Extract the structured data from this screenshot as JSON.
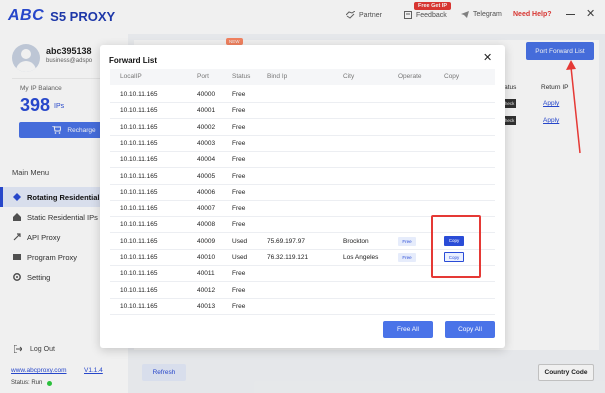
{
  "app": {
    "logo_abc": "ABC",
    "logo_text": "S5 PROXY"
  },
  "topbar": {
    "partner": "Partner",
    "feedback": "Feedback",
    "free_get_ip": "Free Get IP",
    "telegram": "Telegram",
    "need_help": "Need Help?"
  },
  "user": {
    "name": "abc395138",
    "email": "business@adspo"
  },
  "balance": {
    "label": "My IP Balance",
    "value": "398",
    "unit": "IPs",
    "recharge_label": "Recharge"
  },
  "sidebar": {
    "menu_title": "Main Menu",
    "items": [
      {
        "label": "Rotating Residential",
        "icon": "rotate-icon",
        "active": true
      },
      {
        "label": "Static Residential IPs",
        "icon": "house-icon",
        "active": false
      },
      {
        "label": "API Proxy",
        "icon": "api-icon",
        "active": false
      },
      {
        "label": "Program Proxy",
        "icon": "program-icon",
        "active": false
      },
      {
        "label": "Setting",
        "icon": "gear-icon",
        "active": false
      }
    ],
    "logout": "Log Out",
    "site": "www.abcproxy.com",
    "version": "V1.1.4",
    "status": "Status: Run"
  },
  "background": {
    "new_tag": "NEW",
    "port_forward_list": "Port Forward List",
    "col_status": "Status",
    "col_return_ip": "Return IP",
    "check_label": "Check",
    "apply_label": "Apply",
    "refresh": "Refresh",
    "country_code": "Country Code"
  },
  "modal": {
    "title": "Forward List",
    "columns": [
      "LocalIP",
      "Port",
      "Status",
      "Bind Ip",
      "City",
      "Operate",
      "Copy"
    ],
    "rows": [
      {
        "ip": "10.10.11.165",
        "port": "40000",
        "status": "Free",
        "bind": "",
        "city": "",
        "operate": "",
        "copy": ""
      },
      {
        "ip": "10.10.11.165",
        "port": "40001",
        "status": "Free",
        "bind": "",
        "city": "",
        "operate": "",
        "copy": ""
      },
      {
        "ip": "10.10.11.165",
        "port": "40002",
        "status": "Free",
        "bind": "",
        "city": "",
        "operate": "",
        "copy": ""
      },
      {
        "ip": "10.10.11.165",
        "port": "40003",
        "status": "Free",
        "bind": "",
        "city": "",
        "operate": "",
        "copy": ""
      },
      {
        "ip": "10.10.11.165",
        "port": "40004",
        "status": "Free",
        "bind": "",
        "city": "",
        "operate": "",
        "copy": ""
      },
      {
        "ip": "10.10.11.165",
        "port": "40005",
        "status": "Free",
        "bind": "",
        "city": "",
        "operate": "",
        "copy": ""
      },
      {
        "ip": "10.10.11.165",
        "port": "40006",
        "status": "Free",
        "bind": "",
        "city": "",
        "operate": "",
        "copy": ""
      },
      {
        "ip": "10.10.11.165",
        "port": "40007",
        "status": "Free",
        "bind": "",
        "city": "",
        "operate": "",
        "copy": ""
      },
      {
        "ip": "10.10.11.165",
        "port": "40008",
        "status": "Free",
        "bind": "",
        "city": "",
        "operate": "",
        "copy": ""
      },
      {
        "ip": "10.10.11.165",
        "port": "40009",
        "status": "Used",
        "bind": "75.69.197.97",
        "city": "Brockton",
        "operate": "Free",
        "copy": "Copy"
      },
      {
        "ip": "10.10.11.165",
        "port": "40010",
        "status": "Used",
        "bind": "76.32.119.121",
        "city": "Los Angeles",
        "operate": "Free",
        "copy": "Copy"
      },
      {
        "ip": "10.10.11.165",
        "port": "40011",
        "status": "Free",
        "bind": "",
        "city": "",
        "operate": "",
        "copy": ""
      },
      {
        "ip": "10.10.11.165",
        "port": "40012",
        "status": "Free",
        "bind": "",
        "city": "",
        "operate": "",
        "copy": ""
      },
      {
        "ip": "10.10.11.165",
        "port": "40013",
        "status": "Free",
        "bind": "",
        "city": "",
        "operate": "",
        "copy": ""
      }
    ],
    "free_all": "Free All",
    "copy_all": "Copy All"
  },
  "colors": {
    "accent": "#4a73e8",
    "brand": "#2a4cd7",
    "annotation": "#e53935"
  }
}
